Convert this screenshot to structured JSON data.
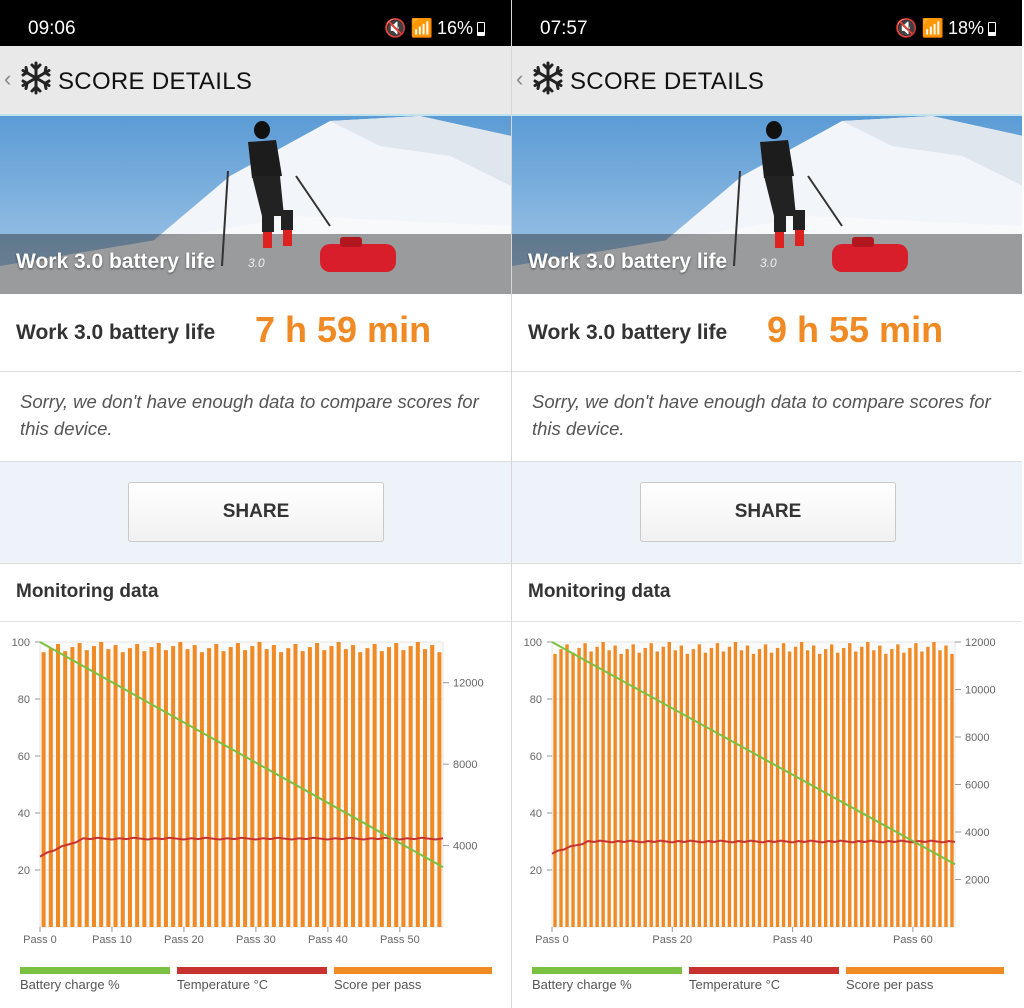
{
  "colors": {
    "battery": "#7ac142",
    "temperature": "#c8322f",
    "score": "#f08a24",
    "accent": "#f08a24"
  },
  "panels": [
    {
      "status": {
        "time": "09:06",
        "battery": "16%"
      },
      "header": {
        "title": "SCORE DETAILS"
      },
      "hero": {
        "caption": "Work 3.0 battery life",
        "version": "3.0"
      },
      "score": {
        "label": "Work 3.0 battery life",
        "value": "7 h 59 min"
      },
      "compare_text": "Sorry, we don't have enough data to compare scores for this device.",
      "share_label": "SHARE",
      "monitoring": {
        "title": "Monitoring data"
      },
      "legend": [
        {
          "label": "Battery charge %"
        },
        {
          "label": "Temperature °C"
        },
        {
          "label": "Score per pass"
        }
      ]
    },
    {
      "status": {
        "time": "07:57",
        "battery": "18%"
      },
      "header": {
        "title": "SCORE DETAILS"
      },
      "hero": {
        "caption": "Work 3.0 battery life",
        "version": "3.0"
      },
      "score": {
        "label": "Work 3.0 battery life",
        "value": "9 h 55 min"
      },
      "compare_text": "Sorry, we don't have enough data to compare scores for this device.",
      "share_label": "SHARE",
      "monitoring": {
        "title": "Monitoring data"
      },
      "legend": [
        {
          "label": "Battery charge %"
        },
        {
          "label": "Temperature °C"
        },
        {
          "label": "Score per pass"
        }
      ]
    }
  ],
  "chart_data": [
    {
      "type": "bar",
      "passes": 56,
      "xticks": [
        "Pass 0",
        "Pass 10",
        "Pass 20",
        "Pass 30",
        "Pass 40",
        "Pass 50"
      ],
      "xtick_values": [
        0,
        10,
        20,
        30,
        40,
        50
      ],
      "y_left": {
        "ticks": [
          20,
          40,
          60,
          80,
          100
        ],
        "range": [
          0,
          100
        ]
      },
      "y_right": {
        "ticks": [
          4000,
          8000,
          12000
        ],
        "range": [
          0,
          14000
        ]
      },
      "series": [
        {
          "name": "Score per pass",
          "axis": "right",
          "value_range": [
            13500,
            14000
          ]
        },
        {
          "name": "Battery charge %",
          "axis": "left",
          "start": 100,
          "end": 21
        },
        {
          "name": "Temperature °C",
          "axis": "left",
          "start": 25,
          "plateau": 31
        }
      ],
      "grid": true,
      "legend_position": "bottom"
    },
    {
      "type": "bar",
      "passes": 67,
      "xticks": [
        "Pass 0",
        "Pass 20",
        "Pass 40",
        "Pass 60"
      ],
      "xtick_values": [
        0,
        20,
        40,
        60
      ],
      "y_left": {
        "ticks": [
          20,
          40,
          60,
          80,
          100
        ],
        "range": [
          0,
          100
        ]
      },
      "y_right": {
        "ticks": [
          2000,
          4000,
          6000,
          8000,
          10000,
          12000
        ],
        "range": [
          0,
          12000
        ]
      },
      "series": [
        {
          "name": "Score per pass",
          "axis": "right",
          "value_range": [
            11500,
            12000
          ]
        },
        {
          "name": "Battery charge %",
          "axis": "left",
          "start": 100,
          "end": 22
        },
        {
          "name": "Temperature °C",
          "axis": "left",
          "start": 26,
          "plateau": 30
        }
      ],
      "grid": true,
      "legend_position": "bottom"
    }
  ]
}
